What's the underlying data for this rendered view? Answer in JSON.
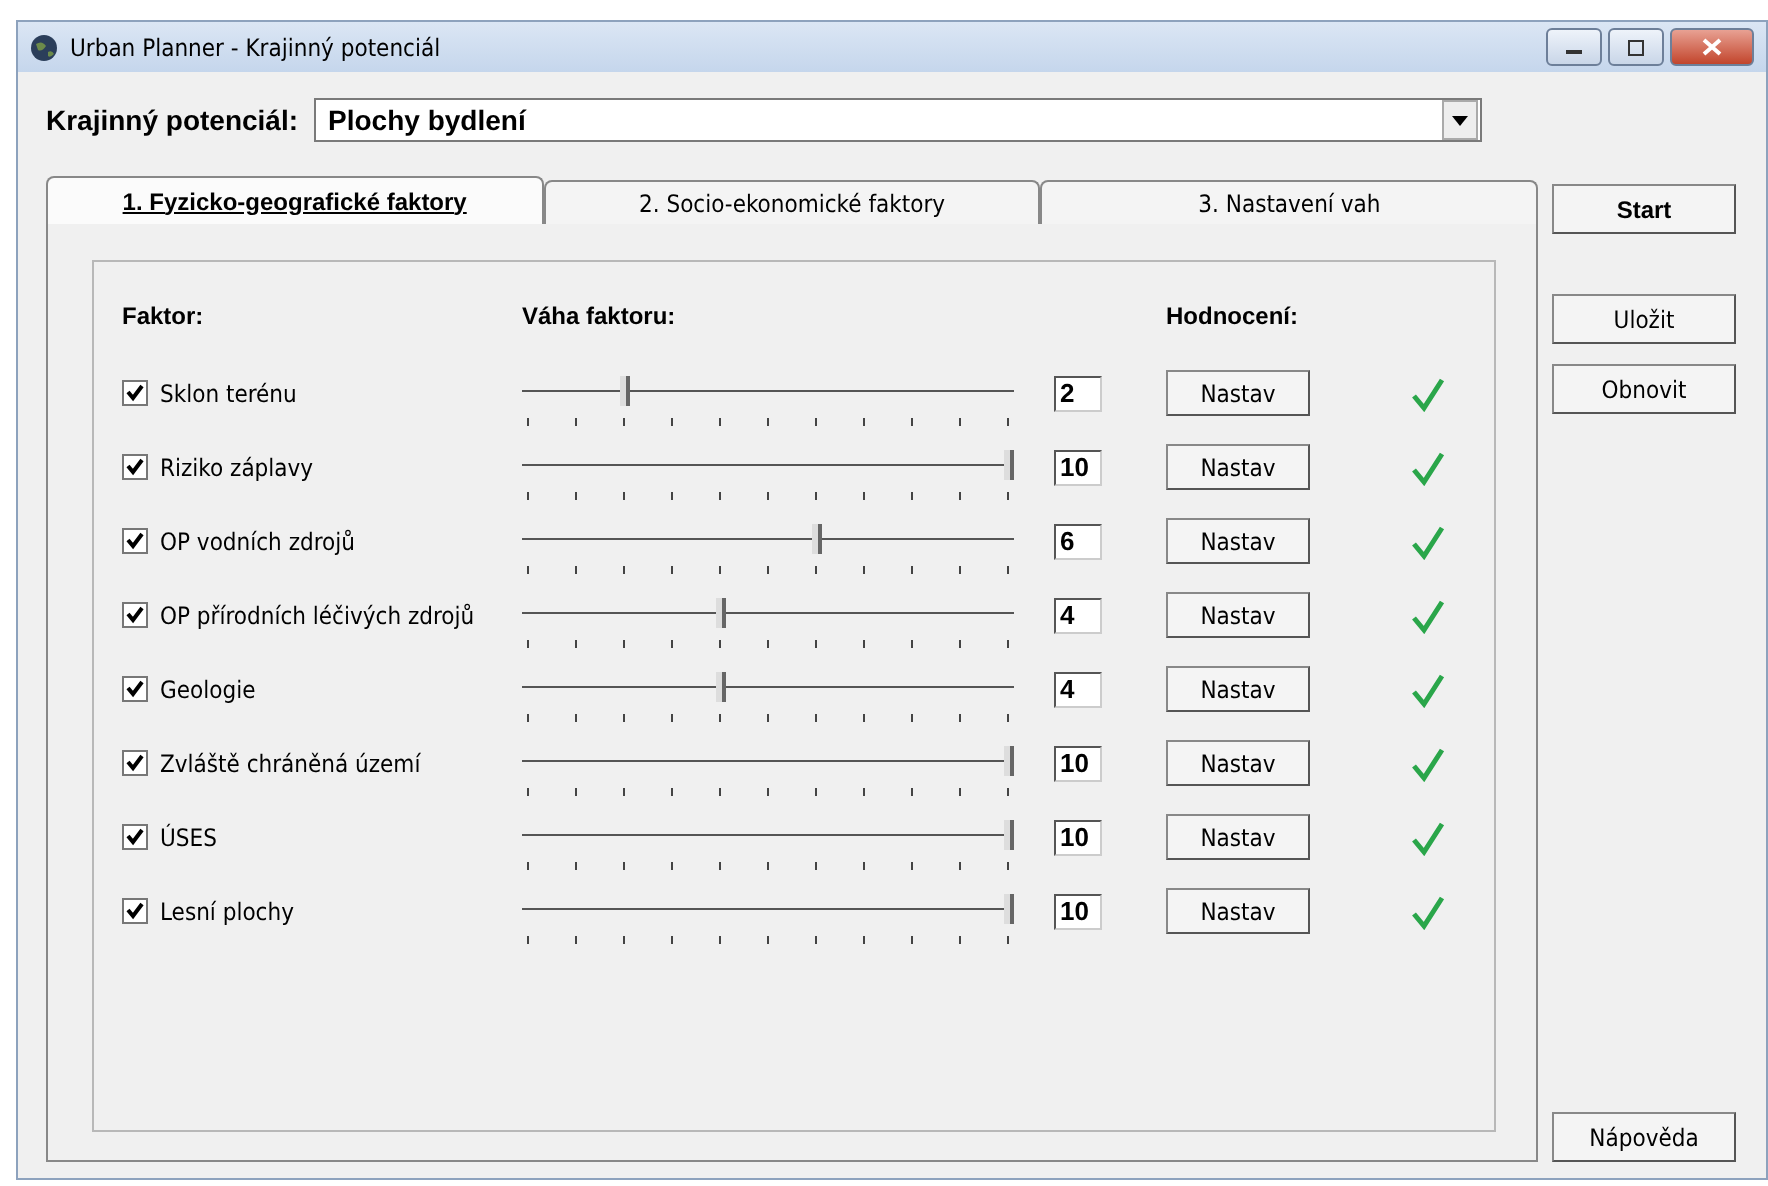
{
  "window": {
    "title": "Urban Planner - Krajinný potenciál"
  },
  "potential": {
    "label": "Krajinný potenciál:",
    "value": "Plochy bydlení"
  },
  "tabs": [
    {
      "label": "1. Fyzicko-geografické faktory",
      "selected": true
    },
    {
      "label": "2. Socio-ekonomické faktory",
      "selected": false
    },
    {
      "label": "3. Nastavení vah",
      "selected": false
    }
  ],
  "headers": {
    "factor": "Faktor:",
    "weight": "Váha faktoru:",
    "rating": "Hodnocení:"
  },
  "factors": [
    {
      "name": "Sklon terénu",
      "checked": true,
      "level": 0.2,
      "value": "2",
      "button": "Nastav",
      "rated": true
    },
    {
      "name": "Riziko záplavy",
      "checked": true,
      "level": 1,
      "value": "10",
      "button": "Nastav",
      "rated": true
    },
    {
      "name": "OP vodních zdrojů",
      "checked": true,
      "level": 0.6,
      "value": "6",
      "button": "Nastav",
      "rated": true
    },
    {
      "name": "OP přírodních léčivých zdrojů",
      "checked": true,
      "level": 0.4,
      "value": "4",
      "button": "Nastav",
      "rated": true
    },
    {
      "name": "Geologie",
      "checked": true,
      "level": 0.4,
      "value": "4",
      "button": "Nastav",
      "rated": true
    },
    {
      "name": "Zvláště chráněná území",
      "checked": true,
      "level": 1,
      "value": "10",
      "button": "Nastav",
      "rated": true
    },
    {
      "name": "ÚSES",
      "checked": true,
      "level": 1,
      "value": "10",
      "button": "Nastav",
      "rated": true
    },
    {
      "name": "Lesní plochy",
      "checked": true,
      "level": 1,
      "value": "10",
      "button": "Nastav",
      "rated": true
    }
  ],
  "side_buttons": {
    "top": [
      "Start",
      "Uložit",
      "Obnovit"
    ],
    "bottom": [
      "Nápověda"
    ]
  }
}
